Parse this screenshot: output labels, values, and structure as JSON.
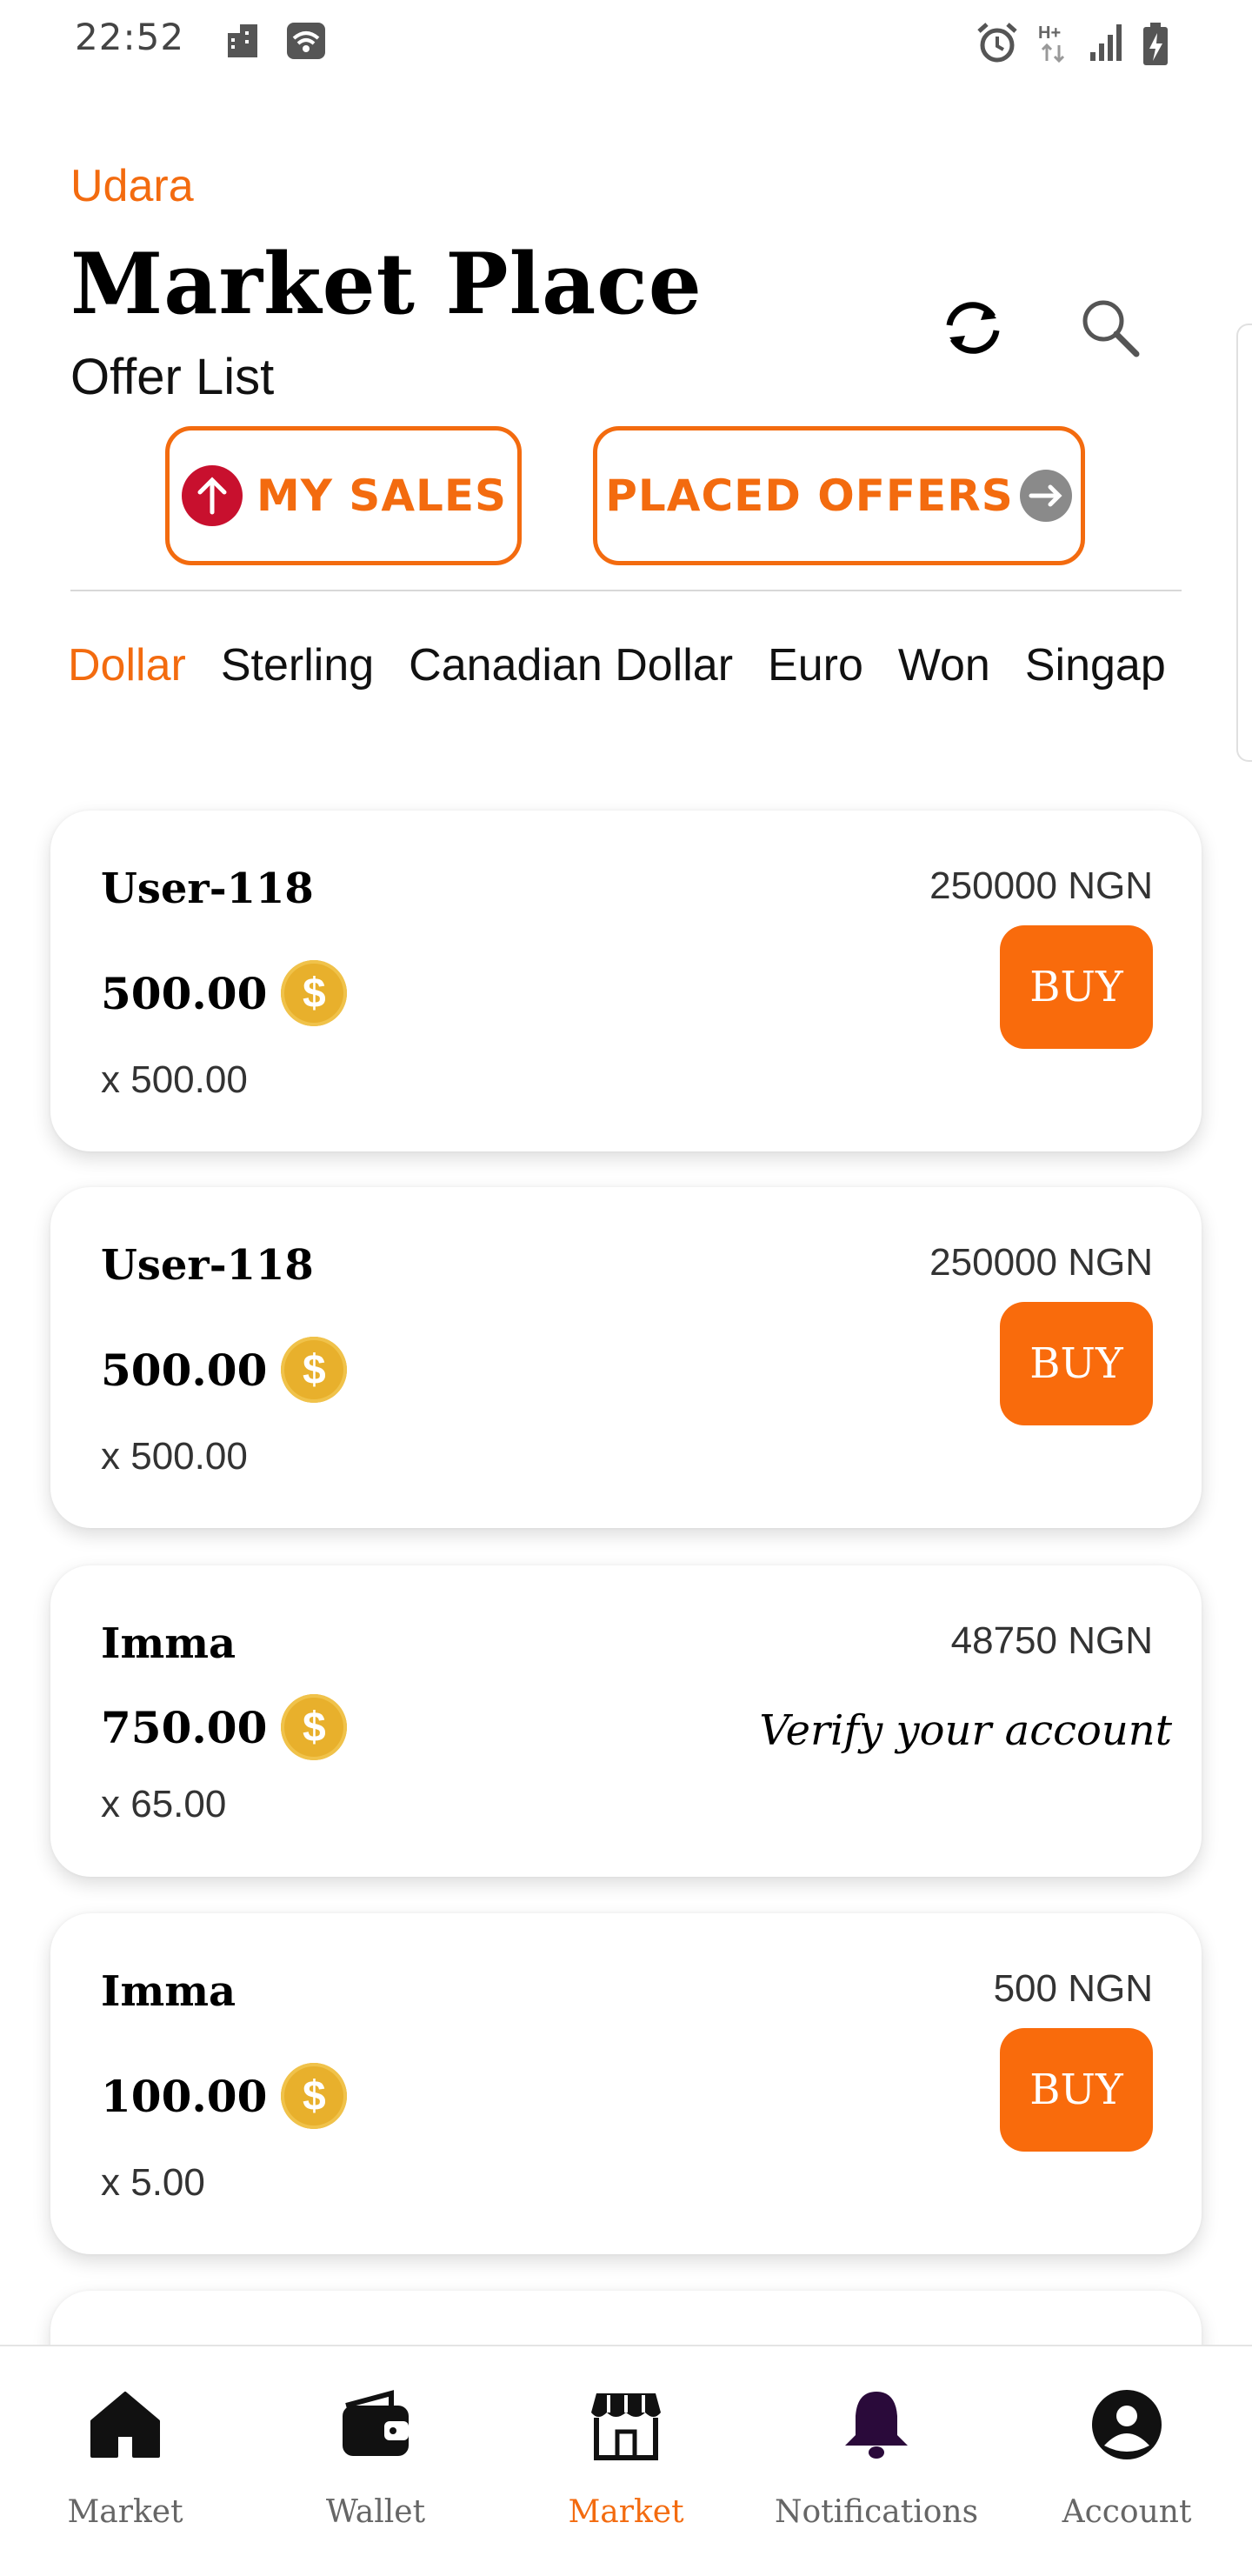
{
  "status_bar": {
    "time": "22:52"
  },
  "header": {
    "brand": "Udara",
    "title": "Market Place",
    "subtitle": "Offer List",
    "refresh_icon": "refresh-icon",
    "search_icon": "search-icon"
  },
  "toggles": {
    "my_sales": "MY SALES",
    "placed_offers": "PLACED OFFERS"
  },
  "currency_tabs": [
    "Dollar",
    "Sterling",
    "Canadian Dollar",
    "Euro",
    "Won",
    "Singap"
  ],
  "active_tab": "Dollar",
  "offers": [
    {
      "user": "User-118",
      "price": "250000 NGN",
      "amount": "500.00",
      "rate": "x 500.00",
      "action": "BUY"
    },
    {
      "user": "User-118",
      "price": "250000 NGN",
      "amount": "500.00",
      "rate": "x 500.00",
      "action": "BUY"
    },
    {
      "user": "Imma",
      "price": "48750 NGN",
      "amount": "750.00",
      "rate": "x 65.00",
      "action": "Verify your account"
    },
    {
      "user": "Imma",
      "price": "500 NGN",
      "amount": "100.00",
      "rate": "x 5.00",
      "action": "BUY"
    }
  ],
  "coin_symbol": "$",
  "bottom_nav": [
    {
      "label": "Market",
      "icon": "home-icon"
    },
    {
      "label": "Wallet",
      "icon": "wallet-icon"
    },
    {
      "label": "Market",
      "icon": "store-icon"
    },
    {
      "label": "Notifications",
      "icon": "bell-icon"
    },
    {
      "label": "Account",
      "icon": "account-icon"
    }
  ],
  "colors": {
    "accent": "#f36b0f",
    "buy": "#f96b0c",
    "coin": "#e8b02c",
    "bell": "#2a0a3a"
  }
}
